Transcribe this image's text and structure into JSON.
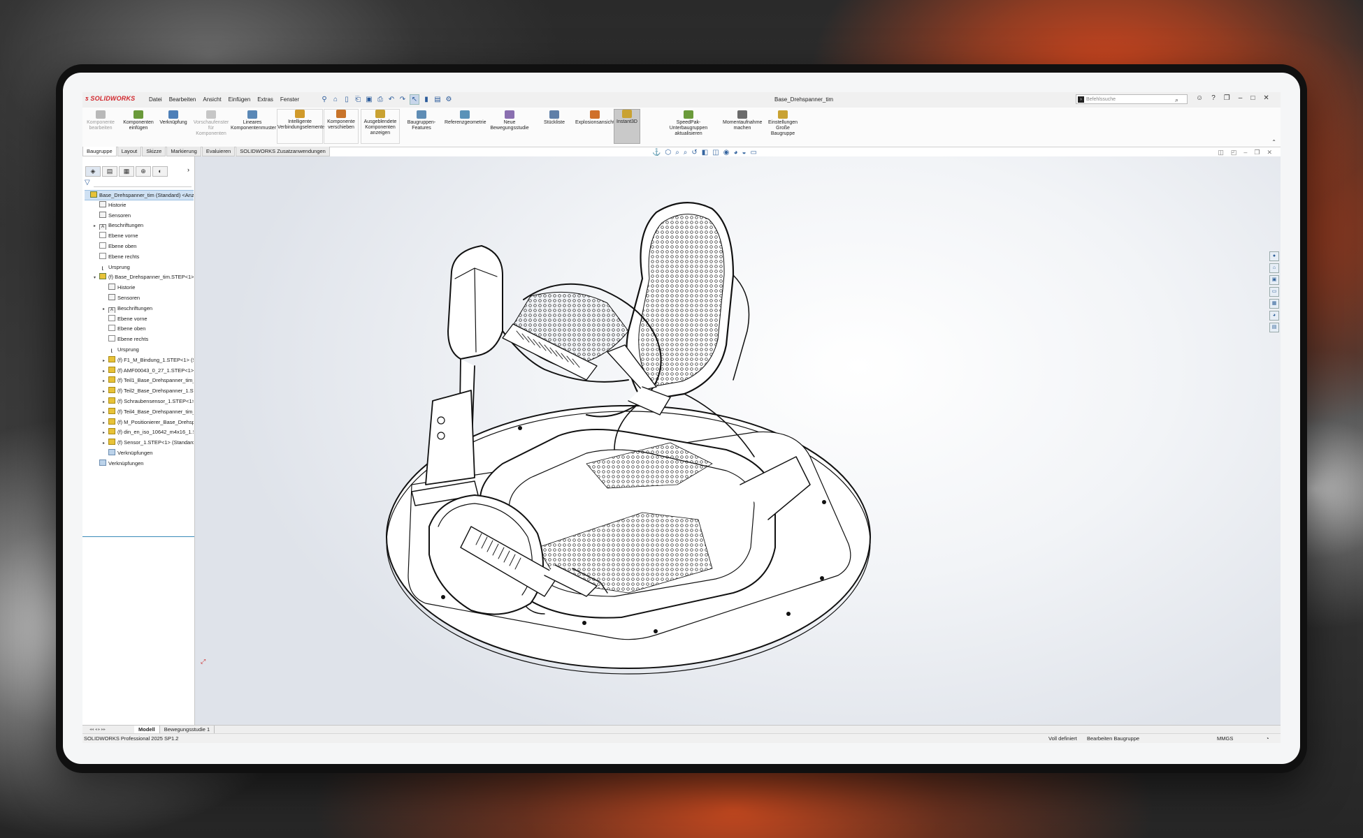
{
  "app": {
    "brand": "SOLIDWORKS",
    "document_title": "Base_Drehspanner_tim"
  },
  "menu": [
    "Datei",
    "Bearbeiten",
    "Ansicht",
    "Einfügen",
    "Extras",
    "Fenster"
  ],
  "search": {
    "placeholder": "Befehlssuche"
  },
  "ribbon": [
    {
      "label": "Komponente bearbeiten",
      "disabled": true,
      "color": "#b9b9b9"
    },
    {
      "label": "Komponenten einfügen",
      "disabled": false,
      "color": "#6a9a3a"
    },
    {
      "label": "Verknüpfung",
      "disabled": false,
      "color": "#4d7fb8"
    },
    {
      "label": "Vorschaufenster für Komponenten",
      "disabled": true,
      "color": "#c6c6c6"
    },
    {
      "label": "Lineares Komponentenmuster",
      "disabled": false,
      "color": "#5a88b6"
    },
    {
      "label": "Intelligente Verbindungselemente",
      "disabled": false,
      "color": "#d09a2b"
    },
    {
      "label": "Komponente verschieben",
      "disabled": false,
      "color": "#c8742a"
    },
    {
      "label": "Ausgeblendete Komponenten anzeigen",
      "disabled": false,
      "color": "#c9a232"
    },
    {
      "label": "Baugruppen-Features",
      "disabled": false,
      "color": "#5f8db5"
    },
    {
      "label": "Referenzgeometrie",
      "disabled": false,
      "color": "#5a92b8"
    },
    {
      "label": "Neue Bewegungsstudie",
      "disabled": false,
      "color": "#8a6fb0"
    },
    {
      "label": "Stückliste",
      "disabled": false,
      "color": "#5f7fa8"
    },
    {
      "label": "Explosionsansicht",
      "disabled": false,
      "color": "#d0702a"
    },
    {
      "label": "Instant3D",
      "disabled": false,
      "active": true,
      "color": "#c9a232"
    },
    {
      "label": "SpeedPak-Unterbaugruppen aktualisieren",
      "disabled": false,
      "color": "#6a9a3a"
    },
    {
      "label": "Momentaufnahme machen",
      "disabled": false,
      "color": "#6b6b6b"
    },
    {
      "label": "Einstellungen Große Baugruppe",
      "disabled": false,
      "color": "#c9a232"
    }
  ],
  "tabs": [
    "Baugruppe",
    "Layout",
    "Skizze",
    "Markierung",
    "Evaluieren",
    "SOLIDWORKS Zusatzanwendungen"
  ],
  "tree": [
    {
      "label": "Base_Drehspanner_tim (Standard) <Anze",
      "icon": "asm",
      "depth": 0,
      "root": true
    },
    {
      "label": "Historie",
      "icon": "hist",
      "depth": 1
    },
    {
      "label": "Sensoren",
      "icon": "hist",
      "depth": 1
    },
    {
      "label": "Beschriftungen",
      "icon": "annot",
      "depth": 1,
      "expand": true
    },
    {
      "label": "Ebene vorne",
      "icon": "plane",
      "depth": 1
    },
    {
      "label": "Ebene oben",
      "icon": "plane",
      "depth": 1
    },
    {
      "label": "Ebene rechts",
      "icon": "plane",
      "depth": 1
    },
    {
      "label": "Ursprung",
      "icon": "orig",
      "depth": 1
    },
    {
      "label": "(f) Base_Drehspanner_tim.STEP<1> <",
      "icon": "asm",
      "depth": 1,
      "expand": true,
      "open": true
    },
    {
      "label": "Historie",
      "icon": "hist",
      "depth": 2
    },
    {
      "label": "Sensoren",
      "icon": "hist",
      "depth": 2
    },
    {
      "label": "Beschriftungen",
      "icon": "annot",
      "depth": 2,
      "expand": true
    },
    {
      "label": "Ebene vorne",
      "icon": "plane",
      "depth": 2
    },
    {
      "label": "Ebene oben",
      "icon": "plane",
      "depth": 2
    },
    {
      "label": "Ebene rechts",
      "icon": "plane",
      "depth": 2
    },
    {
      "label": "Ursprung",
      "icon": "orig",
      "depth": 2
    },
    {
      "label": "(f) F1_M_Bindung_1.STEP<1> (S",
      "icon": "part",
      "depth": 2,
      "expand": true
    },
    {
      "label": "(f) AMF00043_0_27_1.STEP<1> (",
      "icon": "part",
      "depth": 2,
      "expand": true
    },
    {
      "label": "(f) Teil1_Base_Drehspanner_tim_",
      "icon": "part",
      "depth": 2,
      "expand": true
    },
    {
      "label": "(f) Teil2_Base_Drehspanner_1.ST",
      "icon": "part",
      "depth": 2,
      "expand": true
    },
    {
      "label": "(f) Schraubensensor_1.STEP<1>",
      "icon": "part",
      "depth": 2,
      "expand": true
    },
    {
      "label": "(f) Teil4_Base_Drehspanner_tim_",
      "icon": "part",
      "depth": 2,
      "expand": true
    },
    {
      "label": "(f) M_Positionierer_Base_Drehsp",
      "icon": "part",
      "depth": 2,
      "expand": true
    },
    {
      "label": "(f) din_en_iso_10642_m4x16_1.S",
      "icon": "part",
      "depth": 2,
      "expand": true
    },
    {
      "label": "(f) Sensor_1.STEP<1> (Standard",
      "icon": "part",
      "depth": 2,
      "expand": true
    },
    {
      "label": "Verknüpfungen",
      "icon": "mate",
      "depth": 2
    },
    {
      "label": "Verknüpfungen",
      "icon": "mate",
      "depth": 1
    }
  ],
  "bottom_tabs": [
    "Modell",
    "Bewegungsstudie 1"
  ],
  "status": {
    "version": "SOLIDWORKS Professional 2025 SP1.2",
    "definition": "Voll definiert",
    "mode": "Bearbeiten Baugruppe",
    "units": "MMGS"
  },
  "icons": {
    "search": "magnifier-icon",
    "window_controls": [
      "user-icon",
      "help-icon",
      "restore-icon",
      "minimize-icon",
      "maximize-icon",
      "close-icon"
    ]
  }
}
